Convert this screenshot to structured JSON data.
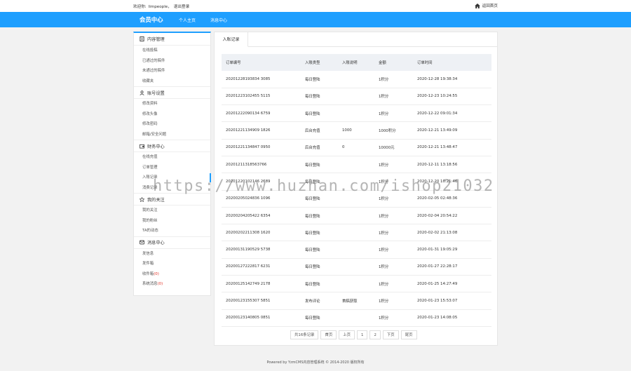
{
  "topbar": {
    "welcome": "欢迎你:",
    "user": "limpeople，",
    "logout": "退出登录",
    "home": "返回首页"
  },
  "header": {
    "brand": "会员中心",
    "nav": [
      "个人主页",
      "消息中心"
    ]
  },
  "sidebar": {
    "sections": [
      {
        "title": "内容管理",
        "icon": "document-icon",
        "items": [
          "在线投稿",
          "已通过的稿件",
          "未通过的稿件",
          "收藏夹"
        ]
      },
      {
        "title": "账号设置",
        "icon": "user-icon",
        "items": [
          "修改资料",
          "修改头像",
          "修改密码",
          "邮箱/安全问题"
        ]
      },
      {
        "title": "财务中心",
        "icon": "wallet-icon",
        "items": [
          "在线充值",
          "订单管理",
          "入账记录",
          "消费记录"
        ]
      },
      {
        "title": "我的关注",
        "icon": "star-icon",
        "items": [
          "我的关注",
          "我的粉丝",
          "TA的动态"
        ]
      },
      {
        "title": "消息中心",
        "icon": "message-icon",
        "items": [
          "发信息",
          "发件箱",
          "收件箱",
          "系统消息"
        ]
      }
    ],
    "inbox_count": "(0)",
    "system_count": "(0)"
  },
  "main": {
    "tab": "入账记录",
    "columns": [
      "订单编号",
      "入账类型",
      "入账说明",
      "金额",
      "订单时间"
    ],
    "rows": [
      [
        "20201228193834 3085",
        "每日登陆",
        "",
        "1积分",
        "2020-12-28 19:38:34"
      ],
      [
        "20201223102455 5115",
        "每日登陆",
        "",
        "1积分",
        "2020-12-23 10:24:55"
      ],
      [
        "20201222090134 6759",
        "每日登陆",
        "",
        "1积分",
        "2020-12-22 09:01:34"
      ],
      [
        "20201221134909 1826",
        "后台充值",
        "1000",
        "1000积分",
        "2020-12-21 13:49:09"
      ],
      [
        "20201221134847 0950",
        "后台充值",
        "0",
        "10000元",
        "2020-12-21 13:48:47"
      ],
      [
        "20201211318563766",
        "每日登陆",
        "",
        "1积分",
        "2020-12-11 13:18:56"
      ],
      [
        "20201220102146 2689",
        "每日登陆",
        "",
        "1积分",
        "2020-12-20 10:21:46"
      ],
      [
        "20200205024836 1096",
        "每日登陆",
        "",
        "1积分",
        "2020-02-05 02:48:36"
      ],
      [
        "20200204205422 6354",
        "每日登陆",
        "",
        "1积分",
        "2020-02-04 20:54:22"
      ],
      [
        "20200202211308 1620",
        "每日登陆",
        "",
        "1积分",
        "2020-02-02 21:13:08"
      ],
      [
        "20200131190529 5738",
        "每日登陆",
        "",
        "1积分",
        "2020-01-31 19:05:29"
      ],
      [
        "20200127222817 6231",
        "每日登陆",
        "",
        "1积分",
        "2020-01-27 22:28:17"
      ],
      [
        "20200125142749 2178",
        "每日登陆",
        "",
        "1积分",
        "2020-01-25 14:27:49"
      ],
      [
        "20200123155307 5851",
        "发布评论",
        "首稿获取",
        "1积分",
        "2020-01-23 15:53:07"
      ],
      [
        "20200123140805 0851",
        "每日登陆",
        "",
        "1积分",
        "2020-01-23 14:08:05"
      ]
    ],
    "pager": [
      "共16条记录",
      "首页",
      "上页",
      "1",
      "2",
      "下页",
      "尾页"
    ]
  },
  "watermark": "https://www.huzhan.com/ishop21032",
  "footer": "Powered by YzmCMS内容管理系统 © 2014-2020 版权所有",
  "colors": {
    "accent": "#1e9fff",
    "count_red": "#e3372b"
  }
}
